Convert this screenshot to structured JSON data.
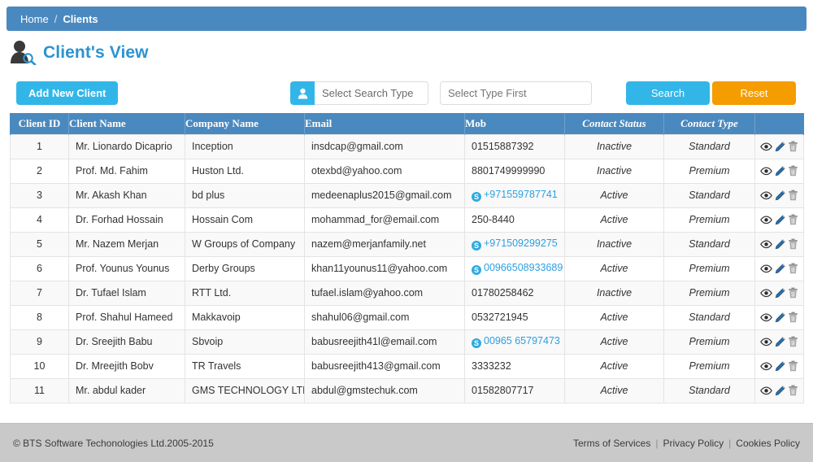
{
  "breadcrumb": {
    "home": "Home",
    "separator": "/",
    "current": "Clients"
  },
  "header": {
    "title": "Client's View",
    "icon": "person-search-icon",
    "accent_color": "#2b93d1",
    "bar_color": "#4a89bf"
  },
  "toolbar": {
    "add_label": "Add New Client",
    "add_color": "#32b6e8",
    "search_type_value": "Select Search Type",
    "search_type_icon": "person-icon",
    "type_first_placeholder": "Select Type First",
    "type_first_value": "",
    "search_label": "Search",
    "search_color": "#32b6e8",
    "reset_label": "Reset",
    "reset_color": "#f59c00"
  },
  "table": {
    "columns": [
      "Client ID",
      "Client Name",
      "Company Name",
      "Email",
      "Mob",
      "Contact Status",
      "Contact Type",
      ""
    ],
    "row_actions": [
      "view-icon",
      "edit-icon",
      "delete-icon"
    ],
    "rows": [
      {
        "id": "1",
        "name": "Mr. Lionardo Dicaprio",
        "company": "Inception",
        "email": "insdcap@gmail.com",
        "mob": "01515887392",
        "mob_is_skype": false,
        "status": "Inactive",
        "type": "Standard"
      },
      {
        "id": "2",
        "name": "Prof. Md. Fahim",
        "company": "Huston Ltd.",
        "email": "otexbd@yahoo.com",
        "mob": "8801749999990",
        "mob_is_skype": false,
        "status": "Inactive",
        "type": "Premium"
      },
      {
        "id": "3",
        "name": "Mr. Akash Khan",
        "company": "bd plus",
        "email": "medeenaplus2015@gmail.com",
        "mob": "+971559787741",
        "mob_is_skype": true,
        "status": "Active",
        "type": "Standard"
      },
      {
        "id": "4",
        "name": "Dr. Forhad Hossain",
        "company": "Hossain Com",
        "email": "mohammad_for@email.com",
        "mob": "250-8440",
        "mob_is_skype": false,
        "status": "Active",
        "type": "Premium"
      },
      {
        "id": "5",
        "name": "Mr. Nazem Merjan",
        "company": "W Groups of Company",
        "email": "nazem@merjanfamily.net",
        "mob": "+971509299275",
        "mob_is_skype": true,
        "status": "Inactive",
        "type": "Standard"
      },
      {
        "id": "6",
        "name": "Prof. Younus Younus",
        "company": "Derby Groups",
        "email": "khan11younus11@yahoo.com",
        "mob": "00966508933689",
        "mob_is_skype": true,
        "status": "Active",
        "type": "Premium"
      },
      {
        "id": "7",
        "name": "Dr. Tufael Islam",
        "company": "RTT Ltd.",
        "email": "tufael.islam@yahoo.com",
        "mob": "01780258462",
        "mob_is_skype": false,
        "status": "Inactive",
        "type": "Premium"
      },
      {
        "id": "8",
        "name": "Prof. Shahul Hameed",
        "company": "Makkavoip",
        "email": "shahul06@gmail.com",
        "mob": "0532721945",
        "mob_is_skype": false,
        "status": "Active",
        "type": "Standard"
      },
      {
        "id": "9",
        "name": "Dr. Sreejith Babu",
        "company": "Sbvoip",
        "email": "babusreejith41l@email.com",
        "mob": "00965 65797473",
        "mob_is_skype": true,
        "status": "Active",
        "type": "Premium"
      },
      {
        "id": "10",
        "name": "Dr. Mreejith Bobv",
        "company": "TR Travels",
        "email": "babusreejith413@gmail.com",
        "mob": "3333232",
        "mob_is_skype": false,
        "status": "Active",
        "type": "Premium"
      },
      {
        "id": "11",
        "name": "Mr. abdul kader",
        "company": "GMS TECHNOLOGY LTD",
        "email": "abdul@gmstechuk.com",
        "mob": "01582807717",
        "mob_is_skype": false,
        "status": "Active",
        "type": "Standard"
      }
    ]
  },
  "footer": {
    "copyright": "© BTS Software Techonologies Ltd.2005-2015",
    "links": [
      "Terms of Services",
      "Privacy Policy",
      "Cookies Policy"
    ],
    "separator": "|"
  }
}
